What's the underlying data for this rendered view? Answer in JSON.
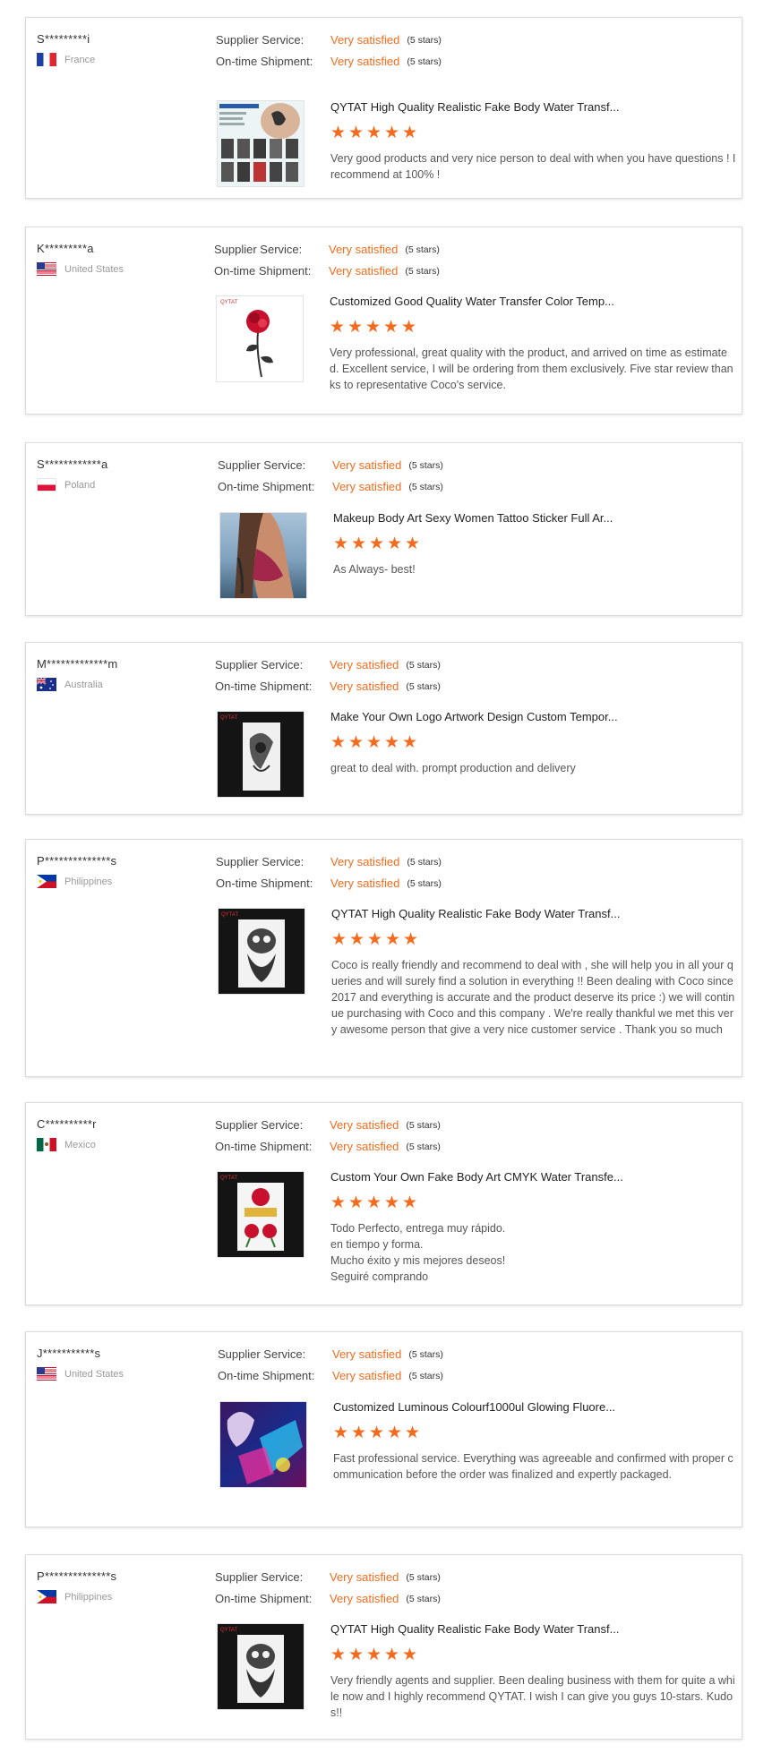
{
  "colors": {
    "accent": "#f56b1d",
    "border": "#dcdcdc"
  },
  "labels": {
    "supplier_service": "Supplier Service:",
    "ontime_shipment": "On-time Shipment:",
    "satisfied": "Very satisfied",
    "stars": "(5 stars)"
  },
  "reviews": [
    {
      "buyer": "S*********i",
      "country": "France",
      "flag": "france-flag-icon",
      "product_title": "QYTAT High Quality Realistic Fake Body Water Transf...",
      "product_image": "tattoo-sheet-thumbnail",
      "rating": 5,
      "text": "Very good products and very nice person to deal with when you have questions ! I recommend at 100% !"
    },
    {
      "buyer": "K*********a",
      "country": "United States",
      "flag": "usa-flag-icon",
      "product_title": "Customized Good Quality Water Transfer Color Temp...",
      "product_image": "red-rose-tattoo-thumbnail",
      "rating": 5,
      "text": "Very professional, great quality with the product, and arrived on time as estimated. Excellent service, I will be ordering from them exclusively. Five star review thanks to representative Coco's service."
    },
    {
      "buyer": "S************a",
      "country": "Poland",
      "flag": "poland-flag-icon",
      "product_title": "Makeup Body Art Sexy Women Tattoo Sticker Full Ar...",
      "product_image": "woman-arm-tattoo-photo",
      "rating": 5,
      "text": "As Always- best!"
    },
    {
      "buyer": "M*************m",
      "country": "Australia",
      "flag": "australia-flag-icon",
      "product_title": "Make Your Own Logo Artwork Design Custom Tempor...",
      "product_image": "dark-tattoo-thumbnail",
      "rating": 5,
      "text": "great to deal with. prompt production and delivery"
    },
    {
      "buyer": "P**************s",
      "country": "Philippines",
      "flag": "philippines-flag-icon",
      "product_title": "QYTAT High Quality Realistic Fake Body Water Transf...",
      "product_image": "skull-tattoo-thumbnail",
      "rating": 5,
      "text": "Coco is really friendly and recommend to deal with , she will help you in all your queries and will surely find a solution in everything !! Been dealing with Coco since 2017 and everything is accurate and the product deserve its price :) we will continue purchasing with Coco and this company . We're really thankful we met this very awesome person that give a very nice customer service . Thank you so much"
    },
    {
      "buyer": "C**********r",
      "country": "Mexico",
      "flag": "mexico-flag-icon",
      "product_title": "Custom Your Own Fake Body Art CMYK Water Transfe...",
      "product_image": "rose-banner-tattoo-thumbnail",
      "rating": 5,
      "text_lines": [
        "Todo Perfecto, entrega muy rápido.",
        "en tiempo y forma.",
        "Mucho éxito y mis mejores deseos!",
        "Seguiré comprando"
      ]
    },
    {
      "buyer": "J***********s",
      "country": "United States",
      "flag": "usa-flag-icon",
      "product_title": "Customized Luminous Colourf1000ul Glowing Fluore...",
      "product_image": "glowing-tattoo-thumbnail",
      "rating": 5,
      "text": "Fast professional service. Everything was agreeable and confirmed with proper communication before the order was finalized and expertly packaged."
    },
    {
      "buyer": "P**************s",
      "country": "Philippines",
      "flag": "philippines-flag-icon",
      "product_title": "QYTAT High Quality Realistic Fake Body Water Transf...",
      "product_image": "skull-tattoo-thumbnail",
      "rating": 5,
      "text": "Very friendly agents and supplier. Been dealing business with them for quite a while now and I highly recommend QYTAT. I wish I can give you guys 10-stars. Kudos!!"
    }
  ]
}
